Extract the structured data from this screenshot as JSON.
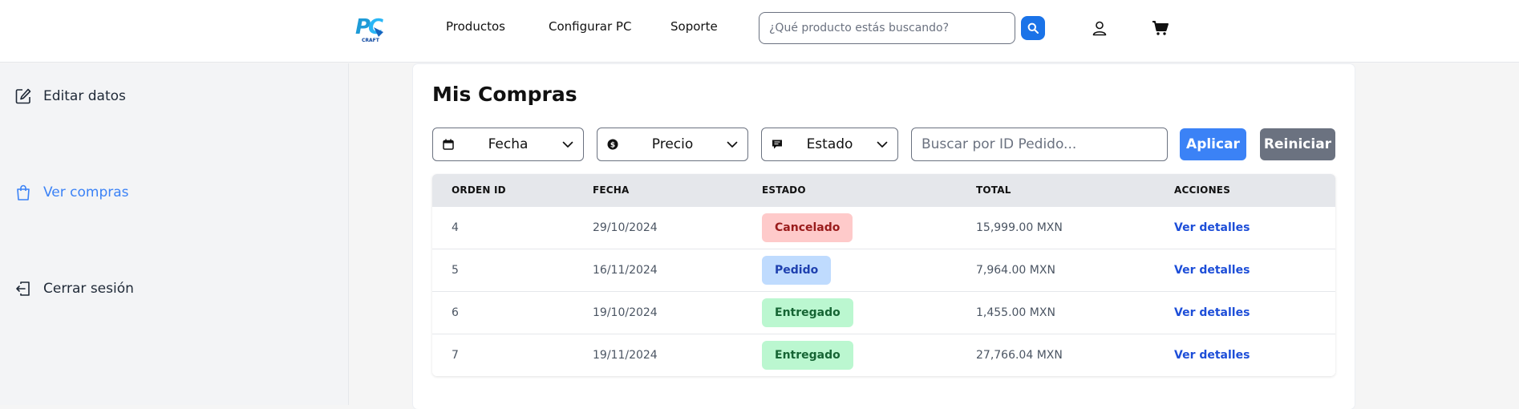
{
  "header": {
    "logo_text": "PC CRAFT",
    "nav": [
      "Productos",
      "Configurar PC",
      "Soporte"
    ],
    "search_placeholder": "¿Qué producto estás buscando?"
  },
  "sidebar": {
    "items": [
      {
        "label": "Editar datos",
        "icon": "edit-icon",
        "active": false
      },
      {
        "label": "Ver compras",
        "icon": "shopping-bag-icon",
        "active": true
      },
      {
        "label": "Cerrar sesión",
        "icon": "logout-icon",
        "active": false
      }
    ]
  },
  "main": {
    "title": "Mis Compras",
    "filters": [
      {
        "label": "Fecha",
        "icon": "calendar-icon"
      },
      {
        "label": "Precio",
        "icon": "dollar-icon"
      },
      {
        "label": "Estado",
        "icon": "comment-icon"
      }
    ],
    "id_search_placeholder": "Buscar por ID Pedido...",
    "apply_label": "Aplicar",
    "reset_label": "Reiniciar",
    "table": {
      "headers": [
        "ORDEN ID",
        "FECHA",
        "ESTADO",
        "TOTAL",
        "ACCIONES"
      ],
      "rows": [
        {
          "id": "4",
          "date": "29/10/2024",
          "status": "Cancelado",
          "total": "15,999.00 MXN",
          "action": "Ver detalles"
        },
        {
          "id": "5",
          "date": "16/11/2024",
          "status": "Pedido",
          "total": "7,964.00 MXN",
          "action": "Ver detalles"
        },
        {
          "id": "6",
          "date": "19/10/2024",
          "status": "Entregado",
          "total": "1,455.00 MXN",
          "action": "Ver detalles"
        },
        {
          "id": "7",
          "date": "19/11/2024",
          "status": "Entregado",
          "total": "27,766.04 MXN",
          "action": "Ver detalles"
        }
      ]
    }
  },
  "colors": {
    "accent": "#3b82f6",
    "cancelado_bg": "#fecaca",
    "cancelado_fg": "#991b1b",
    "pedido_bg": "#bfdbfe",
    "pedido_fg": "#1e40af",
    "entregado_bg": "#bbf7d0",
    "entregado_fg": "#166534"
  }
}
